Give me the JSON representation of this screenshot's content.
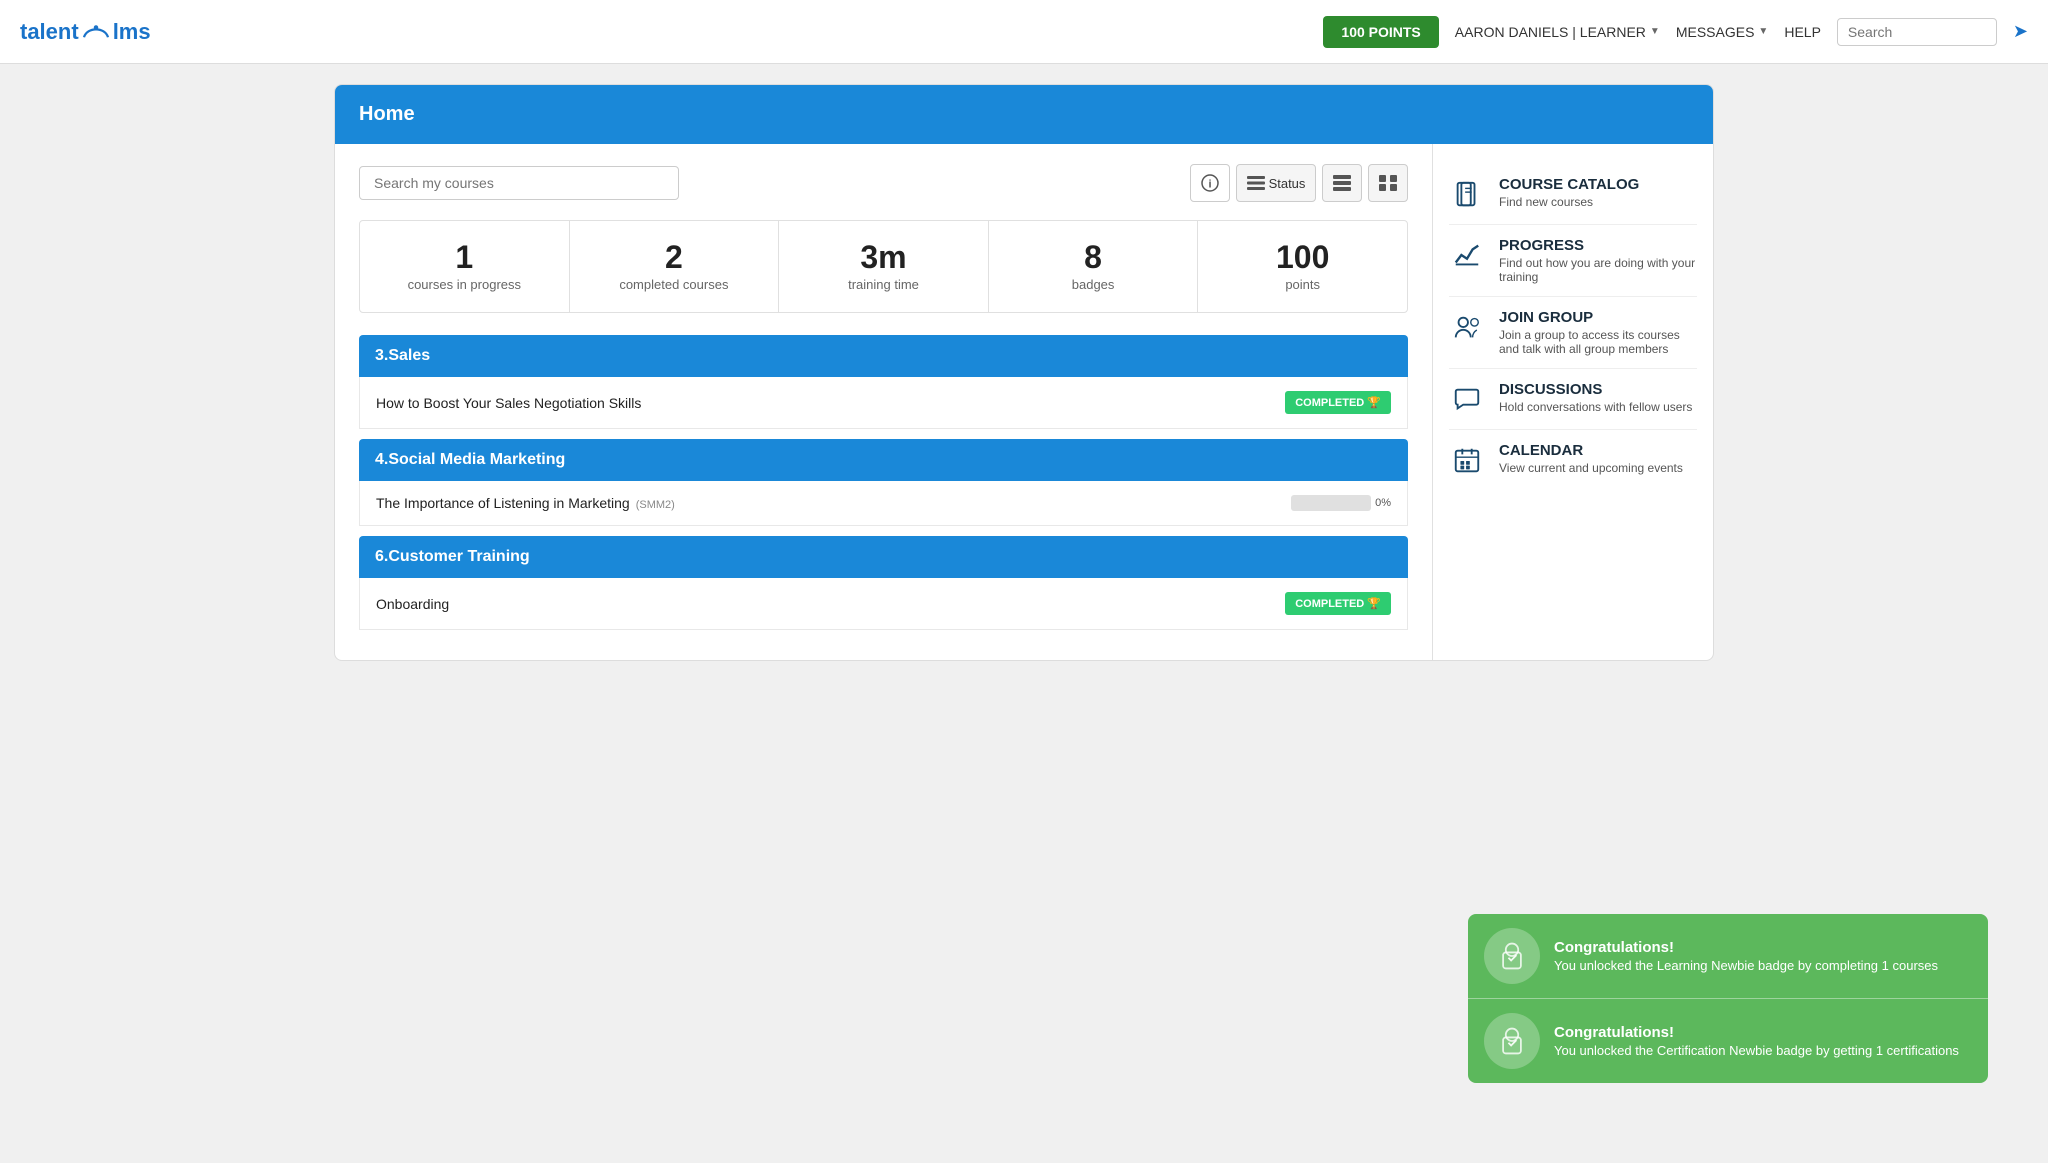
{
  "nav": {
    "logo_talent": "talent",
    "logo_lms": "lms",
    "points_label": "100 POINTS",
    "user_label": "AARON DANIELS | LEARNER",
    "messages_label": "MESSAGES",
    "help_label": "HELP",
    "search_placeholder": "Search",
    "logout_icon": "logout-icon"
  },
  "home": {
    "title": "Home",
    "search_placeholder": "Search my courses",
    "stats": [
      {
        "number": "1",
        "label": "courses in progress"
      },
      {
        "number": "2",
        "label": "completed courses"
      },
      {
        "number": "3m",
        "label": "training time"
      },
      {
        "number": "8",
        "label": "badges"
      },
      {
        "number": "100",
        "label": "points"
      }
    ],
    "groups": [
      {
        "title": "3.Sales",
        "courses": [
          {
            "name": "How to Boost Your Sales Negotiation Skills",
            "status": "completed",
            "progress": 100
          }
        ]
      },
      {
        "title": "4.Social Media Marketing",
        "courses": [
          {
            "name": "The Importance of Listening in Marketing",
            "badge": "(SMM2)",
            "status": "in-progress",
            "progress": 0
          }
        ]
      },
      {
        "title": "6.Customer Training",
        "courses": [
          {
            "name": "Onboarding",
            "status": "completed",
            "progress": 100
          }
        ]
      }
    ],
    "completed_label": "COMPLETED",
    "congratulations": [
      {
        "title": "Congratulations!",
        "message": "You unlocked the Learning Newbie badge by completing 1 courses"
      },
      {
        "title": "Congratulations!",
        "message": "You unlocked the Certification Newbie badge by getting 1 certifications"
      }
    ]
  },
  "sidebar": {
    "items": [
      {
        "id": "course-catalog",
        "title": "COURSE CATALOG",
        "desc": "Find new courses"
      },
      {
        "id": "progress",
        "title": "PROGRESS",
        "desc": "Find out how you are doing with your training"
      },
      {
        "id": "join-group",
        "title": "JOIN GROUP",
        "desc": "Join a group to access its courses and talk with all group members"
      },
      {
        "id": "discussions",
        "title": "DISCUSSIONS",
        "desc": "Hold conversations with fellow users"
      },
      {
        "id": "calendar",
        "title": "CALENDAR",
        "desc": "View current and upcoming events"
      }
    ]
  }
}
